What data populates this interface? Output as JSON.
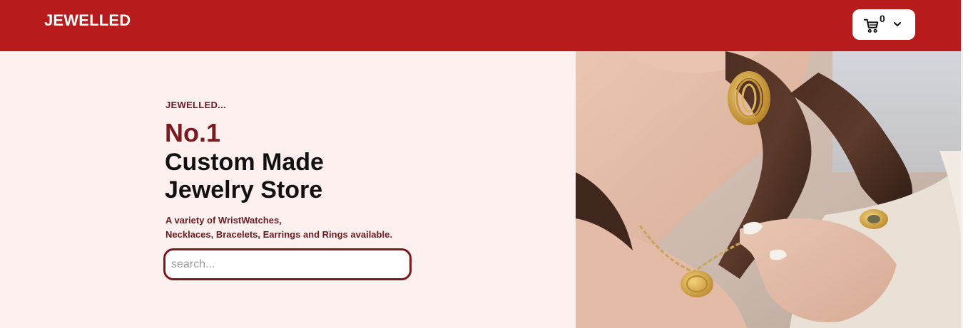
{
  "header": {
    "brand": "JEWELLED",
    "cart_count": "0",
    "cart_icon": "cart-icon",
    "dropdown_icon": "chevron-down-icon"
  },
  "hero": {
    "eyebrow": "JEWELLED...",
    "headline_rank": "No.1",
    "headline_line1": "Custom Made",
    "headline_line2": "Jewelry Store",
    "subtext_line1": "A variety of WristWatches,",
    "subtext_line2": "Necklaces, Bracelets, Earrings and Rings available.",
    "search_placeholder": "search...",
    "search_value": ""
  },
  "colors": {
    "navbar": "#b71b1c",
    "hero_background": "#fff0f0",
    "accent": "#7b1a1e"
  }
}
